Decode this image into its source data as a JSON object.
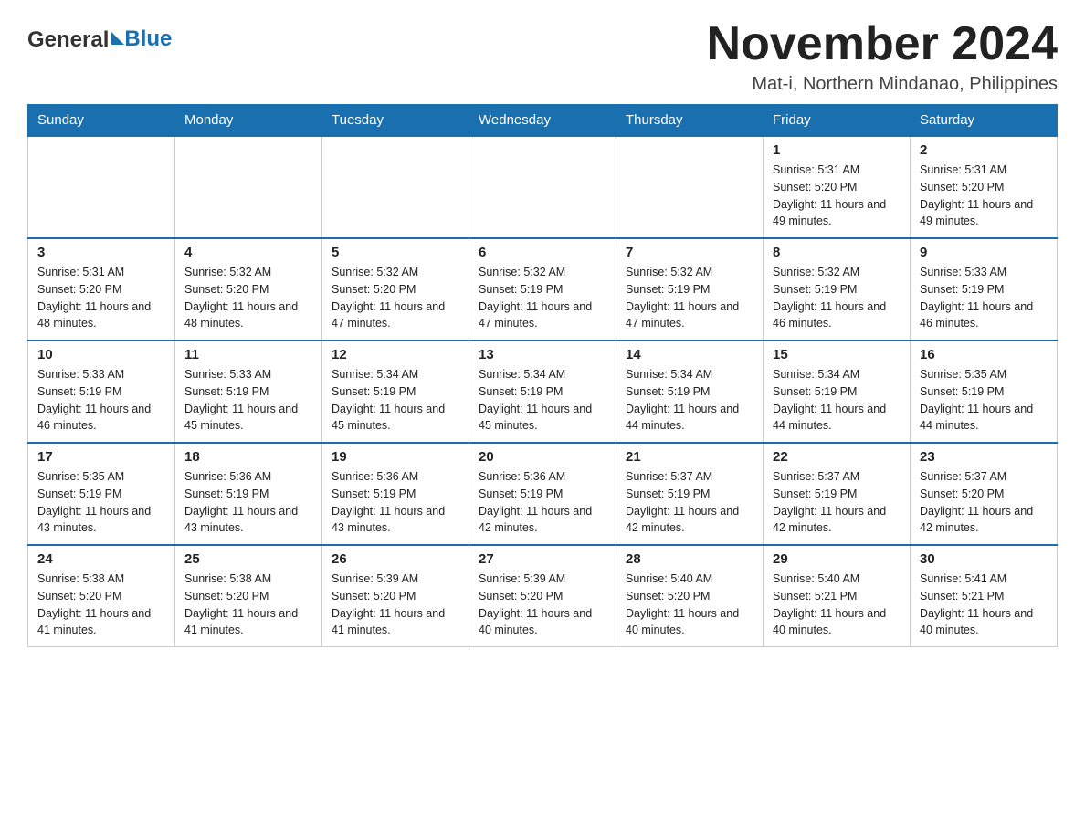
{
  "header": {
    "logo_general": "General",
    "logo_blue": "Blue",
    "month_title": "November 2024",
    "location": "Mat-i, Northern Mindanao, Philippines"
  },
  "weekdays": [
    "Sunday",
    "Monday",
    "Tuesday",
    "Wednesday",
    "Thursday",
    "Friday",
    "Saturday"
  ],
  "weeks": [
    [
      {
        "day": "",
        "sunrise": "",
        "sunset": "",
        "daylight": ""
      },
      {
        "day": "",
        "sunrise": "",
        "sunset": "",
        "daylight": ""
      },
      {
        "day": "",
        "sunrise": "",
        "sunset": "",
        "daylight": ""
      },
      {
        "day": "",
        "sunrise": "",
        "sunset": "",
        "daylight": ""
      },
      {
        "day": "",
        "sunrise": "",
        "sunset": "",
        "daylight": ""
      },
      {
        "day": "1",
        "sunrise": "Sunrise: 5:31 AM",
        "sunset": "Sunset: 5:20 PM",
        "daylight": "Daylight: 11 hours and 49 minutes."
      },
      {
        "day": "2",
        "sunrise": "Sunrise: 5:31 AM",
        "sunset": "Sunset: 5:20 PM",
        "daylight": "Daylight: 11 hours and 49 minutes."
      }
    ],
    [
      {
        "day": "3",
        "sunrise": "Sunrise: 5:31 AM",
        "sunset": "Sunset: 5:20 PM",
        "daylight": "Daylight: 11 hours and 48 minutes."
      },
      {
        "day": "4",
        "sunrise": "Sunrise: 5:32 AM",
        "sunset": "Sunset: 5:20 PM",
        "daylight": "Daylight: 11 hours and 48 minutes."
      },
      {
        "day": "5",
        "sunrise": "Sunrise: 5:32 AM",
        "sunset": "Sunset: 5:20 PM",
        "daylight": "Daylight: 11 hours and 47 minutes."
      },
      {
        "day": "6",
        "sunrise": "Sunrise: 5:32 AM",
        "sunset": "Sunset: 5:19 PM",
        "daylight": "Daylight: 11 hours and 47 minutes."
      },
      {
        "day": "7",
        "sunrise": "Sunrise: 5:32 AM",
        "sunset": "Sunset: 5:19 PM",
        "daylight": "Daylight: 11 hours and 47 minutes."
      },
      {
        "day": "8",
        "sunrise": "Sunrise: 5:32 AM",
        "sunset": "Sunset: 5:19 PM",
        "daylight": "Daylight: 11 hours and 46 minutes."
      },
      {
        "day": "9",
        "sunrise": "Sunrise: 5:33 AM",
        "sunset": "Sunset: 5:19 PM",
        "daylight": "Daylight: 11 hours and 46 minutes."
      }
    ],
    [
      {
        "day": "10",
        "sunrise": "Sunrise: 5:33 AM",
        "sunset": "Sunset: 5:19 PM",
        "daylight": "Daylight: 11 hours and 46 minutes."
      },
      {
        "day": "11",
        "sunrise": "Sunrise: 5:33 AM",
        "sunset": "Sunset: 5:19 PM",
        "daylight": "Daylight: 11 hours and 45 minutes."
      },
      {
        "day": "12",
        "sunrise": "Sunrise: 5:34 AM",
        "sunset": "Sunset: 5:19 PM",
        "daylight": "Daylight: 11 hours and 45 minutes."
      },
      {
        "day": "13",
        "sunrise": "Sunrise: 5:34 AM",
        "sunset": "Sunset: 5:19 PM",
        "daylight": "Daylight: 11 hours and 45 minutes."
      },
      {
        "day": "14",
        "sunrise": "Sunrise: 5:34 AM",
        "sunset": "Sunset: 5:19 PM",
        "daylight": "Daylight: 11 hours and 44 minutes."
      },
      {
        "day": "15",
        "sunrise": "Sunrise: 5:34 AM",
        "sunset": "Sunset: 5:19 PM",
        "daylight": "Daylight: 11 hours and 44 minutes."
      },
      {
        "day": "16",
        "sunrise": "Sunrise: 5:35 AM",
        "sunset": "Sunset: 5:19 PM",
        "daylight": "Daylight: 11 hours and 44 minutes."
      }
    ],
    [
      {
        "day": "17",
        "sunrise": "Sunrise: 5:35 AM",
        "sunset": "Sunset: 5:19 PM",
        "daylight": "Daylight: 11 hours and 43 minutes."
      },
      {
        "day": "18",
        "sunrise": "Sunrise: 5:36 AM",
        "sunset": "Sunset: 5:19 PM",
        "daylight": "Daylight: 11 hours and 43 minutes."
      },
      {
        "day": "19",
        "sunrise": "Sunrise: 5:36 AM",
        "sunset": "Sunset: 5:19 PM",
        "daylight": "Daylight: 11 hours and 43 minutes."
      },
      {
        "day": "20",
        "sunrise": "Sunrise: 5:36 AM",
        "sunset": "Sunset: 5:19 PM",
        "daylight": "Daylight: 11 hours and 42 minutes."
      },
      {
        "day": "21",
        "sunrise": "Sunrise: 5:37 AM",
        "sunset": "Sunset: 5:19 PM",
        "daylight": "Daylight: 11 hours and 42 minutes."
      },
      {
        "day": "22",
        "sunrise": "Sunrise: 5:37 AM",
        "sunset": "Sunset: 5:19 PM",
        "daylight": "Daylight: 11 hours and 42 minutes."
      },
      {
        "day": "23",
        "sunrise": "Sunrise: 5:37 AM",
        "sunset": "Sunset: 5:20 PM",
        "daylight": "Daylight: 11 hours and 42 minutes."
      }
    ],
    [
      {
        "day": "24",
        "sunrise": "Sunrise: 5:38 AM",
        "sunset": "Sunset: 5:20 PM",
        "daylight": "Daylight: 11 hours and 41 minutes."
      },
      {
        "day": "25",
        "sunrise": "Sunrise: 5:38 AM",
        "sunset": "Sunset: 5:20 PM",
        "daylight": "Daylight: 11 hours and 41 minutes."
      },
      {
        "day": "26",
        "sunrise": "Sunrise: 5:39 AM",
        "sunset": "Sunset: 5:20 PM",
        "daylight": "Daylight: 11 hours and 41 minutes."
      },
      {
        "day": "27",
        "sunrise": "Sunrise: 5:39 AM",
        "sunset": "Sunset: 5:20 PM",
        "daylight": "Daylight: 11 hours and 40 minutes."
      },
      {
        "day": "28",
        "sunrise": "Sunrise: 5:40 AM",
        "sunset": "Sunset: 5:20 PM",
        "daylight": "Daylight: 11 hours and 40 minutes."
      },
      {
        "day": "29",
        "sunrise": "Sunrise: 5:40 AM",
        "sunset": "Sunset: 5:21 PM",
        "daylight": "Daylight: 11 hours and 40 minutes."
      },
      {
        "day": "30",
        "sunrise": "Sunrise: 5:41 AM",
        "sunset": "Sunset: 5:21 PM",
        "daylight": "Daylight: 11 hours and 40 minutes."
      }
    ]
  ]
}
